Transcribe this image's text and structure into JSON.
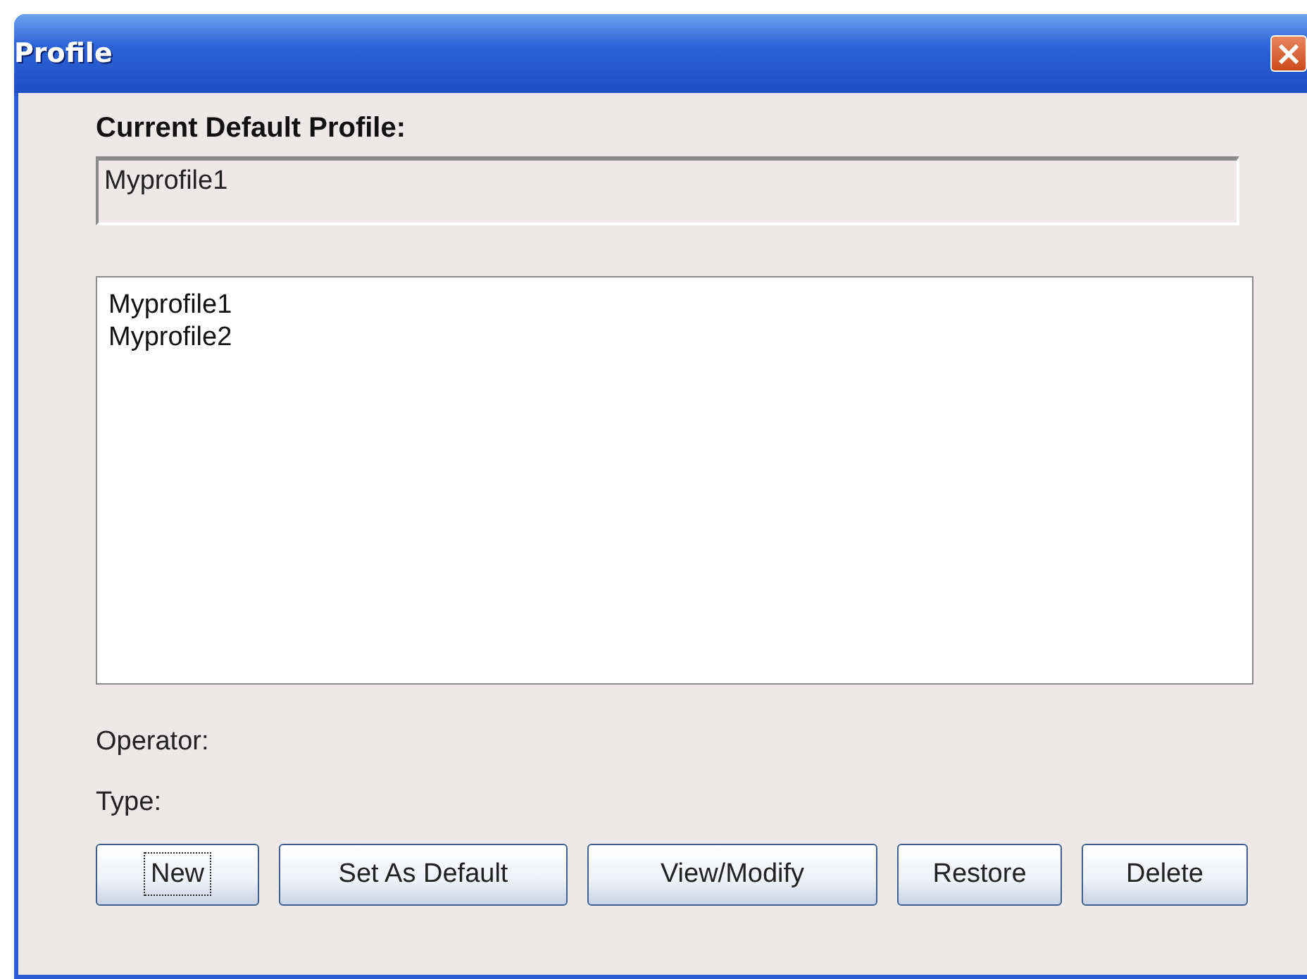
{
  "window": {
    "title": "Profile",
    "close": "×"
  },
  "current_default": {
    "label": "Current Default Profile:",
    "value": "Myprofile1"
  },
  "profiles": [
    {
      "name": "Myprofile1",
      "selected": false
    },
    {
      "name": "Myprofile2",
      "selected": false
    }
  ],
  "details": [
    {
      "label": "Operator:"
    },
    {
      "label": "Type:"
    }
  ],
  "buttons": [
    {
      "label": "New",
      "focused": true
    },
    {
      "label": "Set As Default",
      "focused": false
    },
    {
      "label": "View/Modify",
      "focused": false
    },
    {
      "label": "Restore",
      "focused": false
    },
    {
      "label": "Delete",
      "focused": false
    }
  ]
}
